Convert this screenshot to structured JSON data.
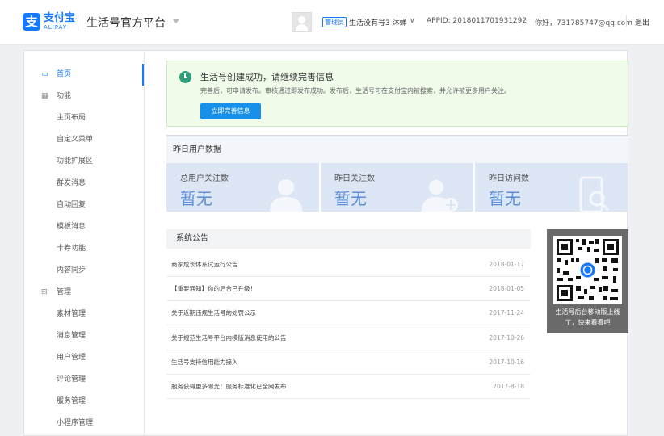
{
  "header": {
    "logo_cn": "支付宝",
    "logo_en": "ALIPAY",
    "platform_title": "生活号官方平台",
    "admin_badge": "管理员",
    "account_name": "生活没有号3 沐蝉",
    "appid": "APPID: 2018011701931292",
    "greeting": "你好，731785747@qq.com",
    "logout": "退出"
  },
  "sidebar": {
    "items": [
      {
        "label": "首页",
        "icon": "monitor-icon",
        "kind": "group",
        "active": true
      },
      {
        "label": "功能",
        "icon": "grid-icon",
        "kind": "group"
      },
      {
        "label": "主页布局",
        "kind": "sub"
      },
      {
        "label": "自定义菜单",
        "kind": "sub"
      },
      {
        "label": "功能扩展区",
        "kind": "sub"
      },
      {
        "label": "群发消息",
        "kind": "sub"
      },
      {
        "label": "自动回复",
        "kind": "sub"
      },
      {
        "label": "模板消息",
        "kind": "sub"
      },
      {
        "label": "卡券功能",
        "kind": "sub"
      },
      {
        "label": "内容同步",
        "kind": "sub"
      },
      {
        "label": "管理",
        "icon": "lock-icon",
        "kind": "group"
      },
      {
        "label": "素材管理",
        "kind": "sub"
      },
      {
        "label": "消息管理",
        "kind": "sub"
      },
      {
        "label": "用户管理",
        "kind": "sub"
      },
      {
        "label": "评论管理",
        "kind": "sub"
      },
      {
        "label": "服务管理",
        "kind": "sub"
      },
      {
        "label": "小程序管理",
        "kind": "sub"
      }
    ]
  },
  "notice": {
    "title": "生活号创建成功，请继续完善信息",
    "desc": "完善后，可申请发布。审核通过即发布成功。发布后，生活号可在支付宝内被搜索，并允许被更多用户关注。",
    "button": "立即完善信息"
  },
  "stats": {
    "heading": "昨日用户数据",
    "cards": [
      {
        "label": "总用户关注数",
        "value": "暂无",
        "icon": "person-icon"
      },
      {
        "label": "昨日关注数",
        "value": "暂无",
        "icon": "person-add-icon"
      },
      {
        "label": "昨日访问数",
        "value": "暂无",
        "icon": "phone-search-icon"
      }
    ]
  },
  "announcements": {
    "heading": "系统公告",
    "rows": [
      {
        "title": "商家成长体系试运行公告",
        "date": "2018-01-17"
      },
      {
        "title": "【重要通知】你的后台已升级！",
        "date": "2018-01-05"
      },
      {
        "title": "关于近期违规生活号的处罚公示",
        "date": "2017-11-24"
      },
      {
        "title": "关于规范生活号平台内模版消息使用的公告",
        "date": "2017-10-26"
      },
      {
        "title": "生活号支持信用能力接入",
        "date": "2017-10-16"
      },
      {
        "title": "服务获得更多曝光！服务标准化已全网发布",
        "date": "2017-8-18"
      }
    ]
  },
  "qr": {
    "caption": "生活号后台移动版上线了，快来看看吧"
  },
  "colors": {
    "brand": "#1677ff",
    "button": "#1890e9",
    "stat_value": "#5b8fd6",
    "stat_bg": "#dde6f4",
    "notice_bg": "#f1fbea"
  }
}
